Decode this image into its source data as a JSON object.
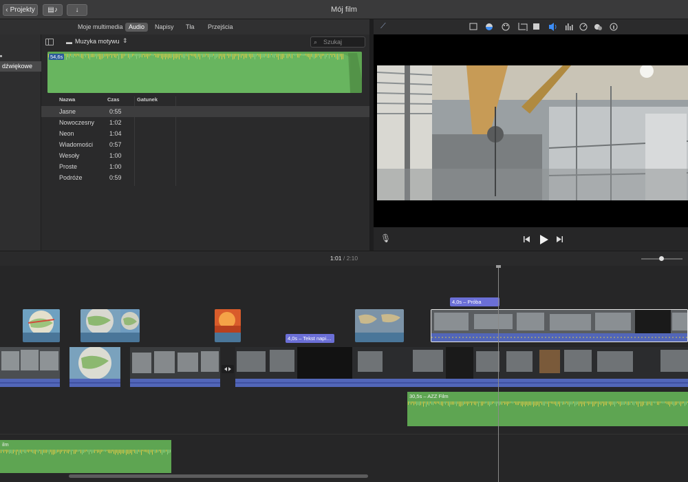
{
  "titlebar": {
    "projects_button": "Projekty",
    "title": "Mój film"
  },
  "browser": {
    "tabs": [
      {
        "label": "Moje multimedia",
        "active": false
      },
      {
        "label": "Audio",
        "active": true
      },
      {
        "label": "Napisy",
        "active": false
      },
      {
        "label": "Tła",
        "active": false
      },
      {
        "label": "Przejścia",
        "active": false
      }
    ],
    "sidebar_selected": "dźwiękowe",
    "category_label": "Muzyka motywu",
    "search_placeholder": "Szukaj",
    "preview_badge": "54,6s",
    "columns": [
      "Nazwa",
      "Czas",
      "Gatunek"
    ],
    "rows": [
      {
        "name": "Jasne",
        "time": "0:55",
        "selected": true
      },
      {
        "name": "Nowoczesny",
        "time": "1:02",
        "selected": false
      },
      {
        "name": "Neon",
        "time": "1:04",
        "selected": false
      },
      {
        "name": "Wiadomości",
        "time": "0:57",
        "selected": false
      },
      {
        "name": "Wesoły",
        "time": "1:00",
        "selected": false
      },
      {
        "name": "Proste",
        "time": "1:00",
        "selected": false
      },
      {
        "name": "Podróże",
        "time": "0:59",
        "selected": false
      }
    ]
  },
  "viewer": {
    "tools": [
      "crop-box-icon",
      "color-balance-icon",
      "palette-icon",
      "crop-icon",
      "camera-stabilize-icon",
      "volume-icon",
      "equalizer-icon",
      "speed-icon",
      "filter-icon",
      "info-icon"
    ],
    "active_tool": "volume-icon"
  },
  "timeline": {
    "current_time": "1:01",
    "separator": "/",
    "total_time": "2:10",
    "title_tag_1": "4,0s – Tekst napi…",
    "title_tag_2": "4,0s – Próba",
    "music_clip_label": "30,5s – AZZ Film",
    "bottom_music_label": "ilm"
  },
  "colors": {
    "audio_waveform": "#5ea552",
    "clip_audio": "#5266b8",
    "title_tag": "#6b6fd6",
    "accent_blue": "#3d8df5"
  }
}
